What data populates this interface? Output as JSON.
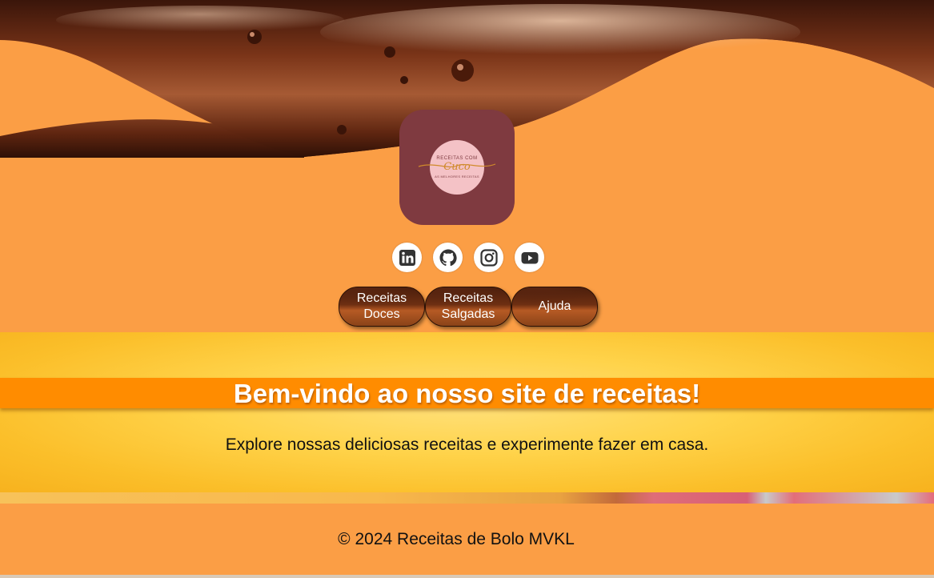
{
  "logo": {
    "top_text": "RECEITAS COM",
    "script_text": "Cuco",
    "bottom_text": "AS MELHORES RECEITAS"
  },
  "socials": [
    {
      "icon": "linkedin-icon"
    },
    {
      "icon": "github-icon"
    },
    {
      "icon": "instagram-icon"
    },
    {
      "icon": "youtube-icon"
    }
  ],
  "nav": {
    "items": [
      {
        "label": "Receitas\nDoces"
      },
      {
        "label": "Receitas\nSalgadas"
      },
      {
        "label": "Ajuda"
      }
    ]
  },
  "hero": {
    "title": "Bem-vindo ao nosso site de receitas!",
    "subtitle": "Explore nossas deliciosas receitas e experimente fazer em casa."
  },
  "footer": {
    "text": "© 2024 Receitas de Bolo MVKL"
  },
  "colors": {
    "background": "#fb9e45",
    "logo_bg": "#7f3a40",
    "hero_band": "#ff8c00",
    "chocolate": "#5a2410"
  }
}
